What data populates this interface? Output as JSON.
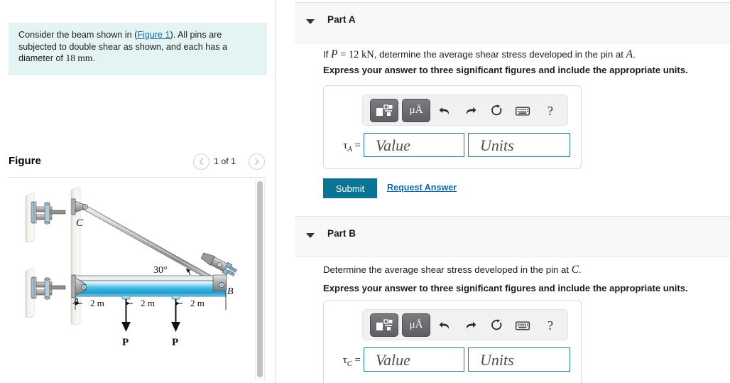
{
  "left": {
    "prompt": {
      "before_link": "Consider the beam shown in (",
      "link": "Figure 1",
      "after_link": "). All pins are subjected to double shear as shown, and each has a diameter of ",
      "diameter": "18 mm",
      "period": "."
    },
    "figure": {
      "title": "Figure",
      "prev_icon": "chevron-left-icon",
      "next_icon": "chevron-right-icon",
      "count": "1 of 1",
      "diagram": {
        "labels": {
          "pin_c": "C",
          "pin_a": "A",
          "pin_b": "B",
          "angle": "30°",
          "dim1": "2 m",
          "dim2": "2 m",
          "dim3": "2 m",
          "load1": "P",
          "load2": "P"
        }
      }
    }
  },
  "right": {
    "parts": [
      {
        "id": "A",
        "caret_icon": "caret-down-icon",
        "label": "Part A",
        "question_pre": "If ",
        "question_var": "P",
        "question_eq": " = ",
        "question_val": "12 kN",
        "question_mid": ", determine the average shear stress developed in the pin at ",
        "question_pin": "A",
        "question_end": ".",
        "instruction": "Express your answer to three significant figures and include the appropriate units.",
        "answer": {
          "tau_symbol": "τ",
          "tau_sub": "A",
          "equals": "=",
          "value_placeholder": "Value",
          "units_placeholder": "Units",
          "value": "",
          "units": ""
        },
        "toolbar": {
          "template_icon": "math-template-icon",
          "units_label": "μÅ",
          "undo_icon": "undo-arrow-icon",
          "redo_icon": "redo-arrow-icon",
          "reset_icon": "reset-circular-arrow-icon",
          "keyboard_icon": "keyboard-icon",
          "help_label": "?"
        },
        "submit_label": "Submit",
        "request_answer_label": "Request Answer"
      },
      {
        "id": "B",
        "caret_icon": "caret-down-icon",
        "label": "Part B",
        "question_pre": "Determine the average shear stress developed in the pin at ",
        "question_pin": "C",
        "question_end": ".",
        "instruction": "Express your answer to three significant figures and include the appropriate units.",
        "answer": {
          "tau_symbol": "τ",
          "tau_sub": "C",
          "equals": "=",
          "value_placeholder": "Value",
          "units_placeholder": "Units",
          "value": "",
          "units": ""
        },
        "toolbar": {
          "template_icon": "math-template-icon",
          "units_label": "μÅ",
          "undo_icon": "undo-arrow-icon",
          "redo_icon": "redo-arrow-icon",
          "reset_icon": "reset-circular-arrow-icon",
          "keyboard_icon": "keyboard-icon",
          "help_label": "?"
        }
      }
    ]
  },
  "colors": {
    "prompt_bg": "#e3f4f3",
    "link": "#1a6aa8",
    "submit_bg": "#0b7495",
    "field_border": "#1f7a8c",
    "header_bg": "#f8f8f8",
    "beam_blue": "#2fb6e0"
  }
}
